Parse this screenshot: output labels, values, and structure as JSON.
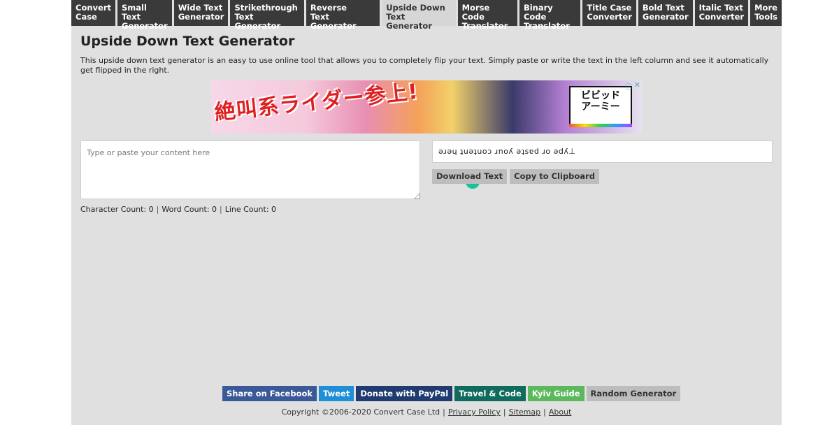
{
  "nav": [
    {
      "label": "Convert\nCase",
      "active": false
    },
    {
      "label": "Small Text\nGenerator",
      "active": false
    },
    {
      "label": "Wide Text\nGenerator",
      "active": false
    },
    {
      "label": "Strikethrough\nText Generator",
      "active": false
    },
    {
      "label": "Reverse\nText Generator",
      "active": false
    },
    {
      "label": "Upside Down\nText Generator",
      "active": true
    },
    {
      "label": "Morse Code\nTranslator",
      "active": false
    },
    {
      "label": "Binary Code\nTranslator",
      "active": false
    },
    {
      "label": "Title Case\nConverter",
      "active": false
    },
    {
      "label": "Bold Text\nGenerator",
      "active": false
    },
    {
      "label": "Italic Text\nConverter",
      "active": false
    },
    {
      "label": "More\nTools",
      "active": false
    }
  ],
  "main": {
    "title": "Upside Down Text Generator",
    "description": "This upside down text generator is an easy to use online tool that allows you to completely flip your text. Simply paste or write the text in the left column and see it automatically get flipped in the right."
  },
  "ad": {
    "headline": "絶叫系ライダー参上!",
    "logo_text": "ビビッド\nアーミー",
    "info_icon": "info-icon",
    "close_icon": "close-icon"
  },
  "input": {
    "placeholder": "Type or paste your content here",
    "value": "",
    "grammarly_icon": "G"
  },
  "counts": {
    "character_label": "Character Count: 0",
    "word_label": "Word Count: 0",
    "line_label": "Line Count: 0"
  },
  "output": {
    "value": "ǝɹǝɥ ʇuǝʇuoɔ ɹnoʎ ǝʇsɐd ɹo ǝdʎ⊥"
  },
  "buttons": {
    "download": "Download Text",
    "copy": "Copy to Clipboard"
  },
  "share": [
    {
      "label": "Share on Facebook",
      "color": "#3b5998"
    },
    {
      "label": "Tweet",
      "color": "#1d8fd6"
    },
    {
      "label": "Donate with PayPal",
      "color": "#1f3b6f"
    },
    {
      "label": "Travel & Code",
      "color": "#0f6b5c"
    },
    {
      "label": "Kyiv Guide",
      "color": "#5cb85c"
    },
    {
      "label": "Random Generator",
      "color": "#bdbdbd"
    }
  ],
  "footer": {
    "copyright": "Copyright ©2006-2020 Convert Case Ltd",
    "privacy": "Privacy Policy",
    "sitemap": "Sitemap",
    "about": "About"
  }
}
